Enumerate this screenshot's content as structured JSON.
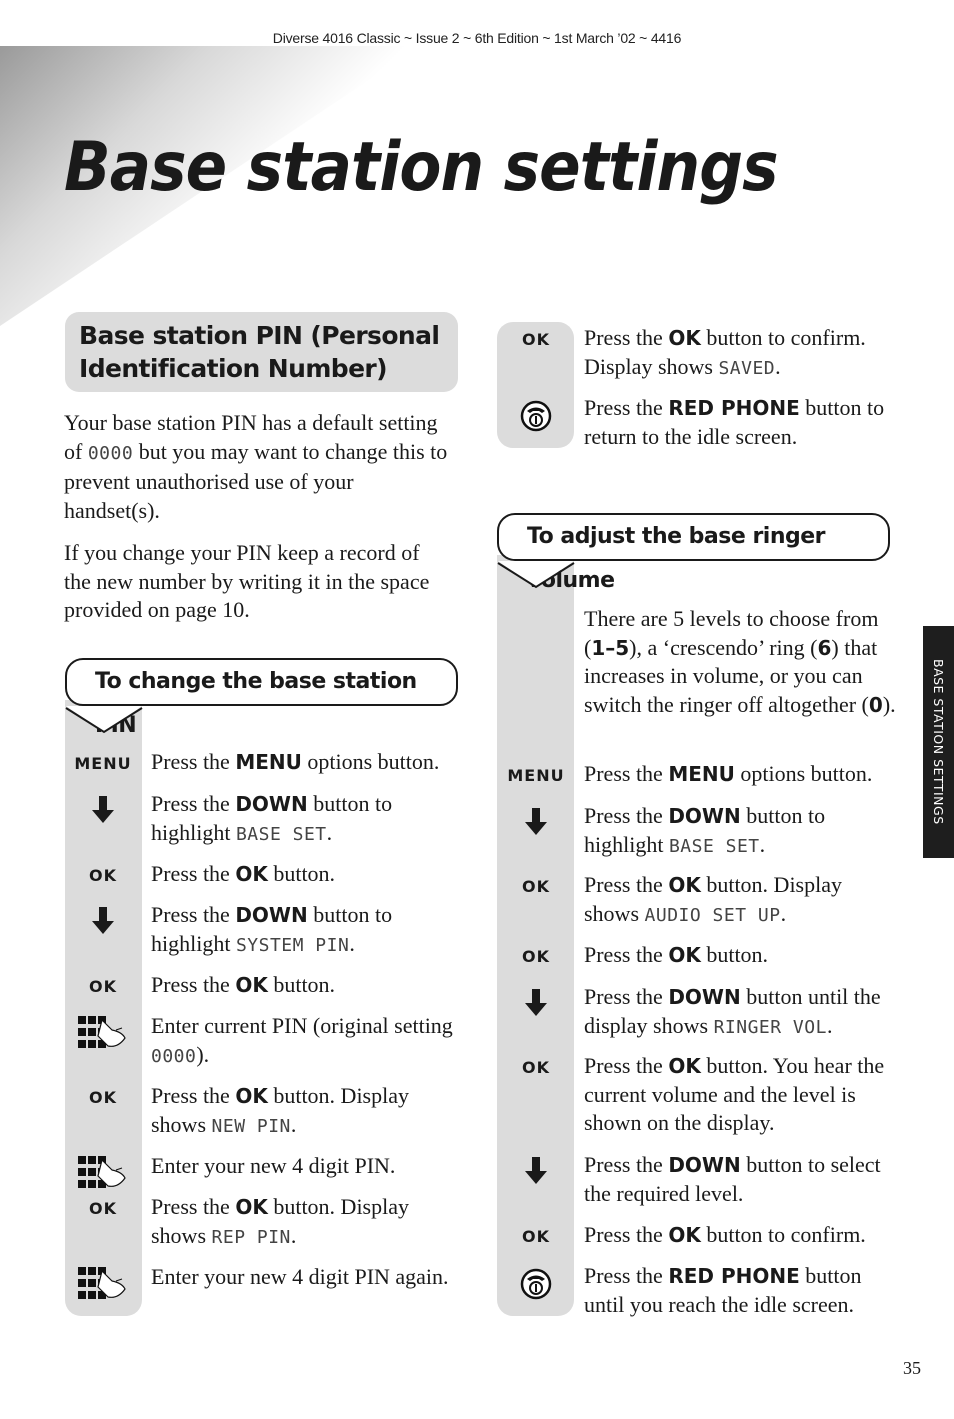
{
  "header": "Diverse 4016 Classic ~ Issue 2 ~ 6th Edition ~ 1st March ’02 ~ 4416",
  "title": "Base station settings",
  "side_tab": "BASE STATION SETTINGS",
  "page_number": "35",
  "pin_section": {
    "heading": "Base station PIN (Personal Identification Number)",
    "para1": [
      "Your base station PIN has a default setting of ",
      "0000",
      " but you may want to change this to prevent unauthorised use of your handset(s)."
    ],
    "para2": "If you change your PIN keep a record of the new number by writing it in the space provided on page 10."
  },
  "change_pin": {
    "title": "To change the base station PIN",
    "steps": [
      {
        "icon": "menu-key",
        "label": "MENU",
        "parts": [
          "Press the ",
          "MENU",
          " options button."
        ]
      },
      {
        "icon": "down-arrow",
        "parts": [
          "Press the ",
          "DOWN",
          " button to highlight ",
          "BASE SET",
          "."
        ]
      },
      {
        "icon": "ok-key",
        "label": "OK",
        "parts": [
          "Press the ",
          "OK",
          " button."
        ]
      },
      {
        "icon": "down-arrow",
        "parts": [
          "Press the ",
          "DOWN",
          " button to highlight ",
          "SYSTEM PIN",
          "."
        ]
      },
      {
        "icon": "ok-key",
        "label": "OK",
        "parts": [
          "Press the ",
          "OK",
          " button."
        ]
      },
      {
        "icon": "keypad",
        "parts": [
          "Enter current PIN (original setting ",
          "0000",
          ")."
        ]
      },
      {
        "icon": "ok-key",
        "label": "OK",
        "parts": [
          "Press the ",
          "OK",
          " button. Display shows ",
          "NEW PIN",
          "."
        ]
      },
      {
        "icon": "keypad",
        "parts": [
          "Enter your new 4 digit PIN."
        ]
      },
      {
        "icon": "ok-key",
        "label": "OK",
        "parts": [
          "Press the ",
          "OK",
          " button. Display shows ",
          "REP PIN",
          "."
        ]
      },
      {
        "icon": "keypad",
        "parts": [
          "Enter your new 4 digit PIN again."
        ]
      }
    ]
  },
  "continued": {
    "steps": [
      {
        "icon": "ok-key",
        "label": "OK",
        "parts": [
          "Press the ",
          "OK",
          " button to confirm. Display shows ",
          "SAVED",
          "."
        ]
      },
      {
        "icon": "red-phone",
        "parts": [
          "Press the ",
          "RED PHONE",
          " button to return to the idle screen."
        ]
      }
    ]
  },
  "ringer": {
    "title": "To adjust the base ringer volume",
    "intro": [
      "There are 5 levels to choose from (",
      "1–5",
      "), a ‘crescendo’ ring (",
      "6",
      ") that increases in volume, or you can switch the ringer off altogether (",
      "0",
      ")."
    ],
    "steps": [
      {
        "icon": "menu-key",
        "label": "MENU",
        "parts": [
          "Press the ",
          "MENU",
          " options button."
        ]
      },
      {
        "icon": "down-arrow",
        "parts": [
          "Press the ",
          "DOWN",
          " button to highlight ",
          "BASE SET",
          "."
        ]
      },
      {
        "icon": "ok-key",
        "label": "OK",
        "parts": [
          "Press the ",
          "OK",
          " button. Display shows ",
          "AUDIO SET UP",
          "."
        ]
      },
      {
        "icon": "ok-key",
        "label": "OK",
        "parts": [
          "Press the ",
          "OK",
          " button."
        ]
      },
      {
        "icon": "down-arrow",
        "parts": [
          "Press the ",
          "DOWN",
          " button until the display shows ",
          "RINGER VOL",
          "."
        ]
      },
      {
        "icon": "ok-key",
        "label": "OK",
        "parts": [
          "Press the ",
          "OK",
          " button. You hear the current volume and the level is shown on the display."
        ]
      },
      {
        "icon": "down-arrow",
        "parts": [
          "Press the ",
          "DOWN",
          " button to select the required level."
        ]
      },
      {
        "icon": "ok-key",
        "label": "OK",
        "parts": [
          "Press the ",
          "OK",
          " button to confirm."
        ]
      },
      {
        "icon": "red-phone",
        "parts": [
          "Press the ",
          "RED PHONE",
          " button until you reach the idle screen."
        ]
      }
    ]
  }
}
